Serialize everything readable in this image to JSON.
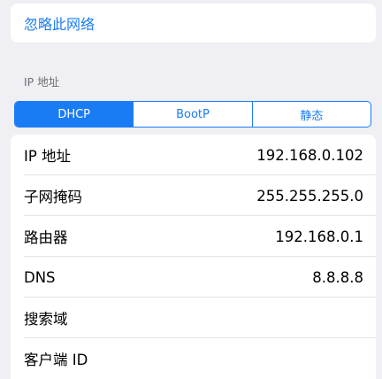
{
  "forget_network": {
    "label": "忽略此网络"
  },
  "ip_section": {
    "header": "IP 地址"
  },
  "segmented": {
    "options": [
      "DHCP",
      "BootP",
      "静态"
    ],
    "selected": "DHCP"
  },
  "rows": [
    {
      "label": "IP 地址",
      "value": "192.168.0.102"
    },
    {
      "label": "子网掩码",
      "value": "255.255.255.0"
    },
    {
      "label": "路由器",
      "value": "192.168.0.1"
    },
    {
      "label": "DNS",
      "value": "8.8.8.8"
    },
    {
      "label": "搜索域",
      "value": ""
    },
    {
      "label": "客户端 ID",
      "value": ""
    }
  ],
  "colors": {
    "accent": "#1a7cf5",
    "background": "#efeff4",
    "card": "#ffffff"
  }
}
